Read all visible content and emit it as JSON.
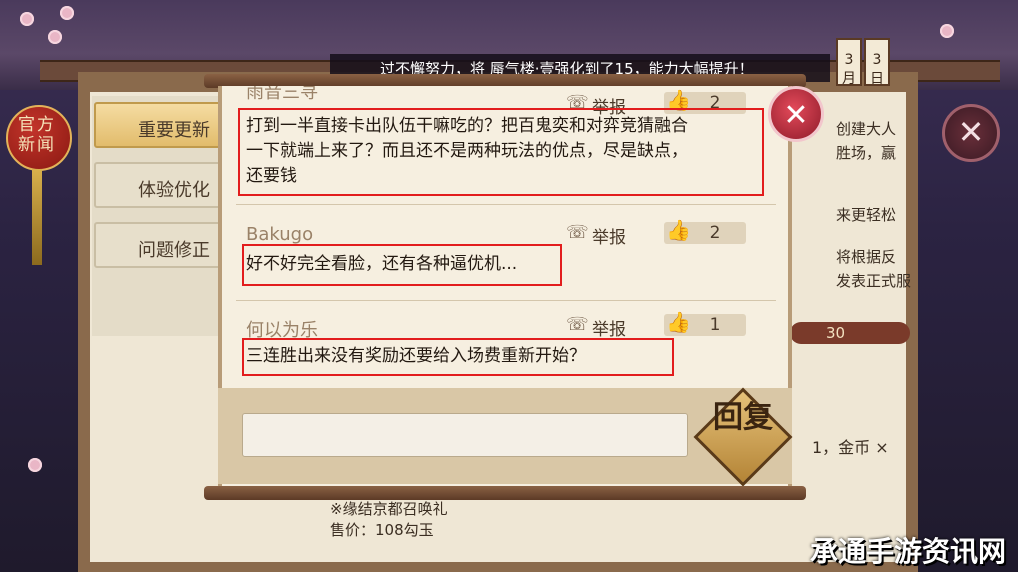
{
  "notice": {
    "text": "过不懈努力，将 蜃气楼·壹强化到了15，能力大幅提升！"
  },
  "calendar": {
    "left": "3月",
    "right": "3日"
  },
  "ornament": {
    "label": "官方新闻"
  },
  "back_panel": {
    "tabs": [
      {
        "label": "重要更新"
      },
      {
        "label": "体验优化"
      },
      {
        "label": "问题修正"
      }
    ],
    "right_snippets": [
      "创建大人",
      "胜场，赢",
      "来更轻松",
      "将根据反",
      "发表正式服"
    ],
    "counter_value": "30",
    "coin_text": "1，金币 ×",
    "bottom_lines": [
      "※缘结京都召唤礼",
      "售价：108勾玉"
    ],
    "close_icon": "close-icon"
  },
  "comments": [
    {
      "name": "雨音三寻",
      "report_label": "举报",
      "likes": "2",
      "text_lines": [
        "打到一半直接卡出队伍干嘛吃的？把百鬼奕和对弈竞猜融合",
        "一下就端上来了？而且还不是两种玩法的优点，尽是缺点，",
        "还要钱"
      ]
    },
    {
      "name": "Bakugo",
      "report_label": "举报",
      "likes": "2",
      "text_lines": [
        "好不好完全看脸，还有各种逼优机..."
      ]
    },
    {
      "name": "何以为乐",
      "report_label": "举报",
      "likes": "1",
      "text_lines": [
        "三连胜出来没有奖励还要给入场费重新开始？"
      ]
    }
  ],
  "reply": {
    "input_value": "",
    "input_placeholder": "",
    "button_label": "回复"
  },
  "colors": {
    "highlight": "#e21d1d",
    "panel_bg": "#f6efe0",
    "accent_gold": "#e6c27a"
  },
  "watermark": "承通手游资讯网"
}
